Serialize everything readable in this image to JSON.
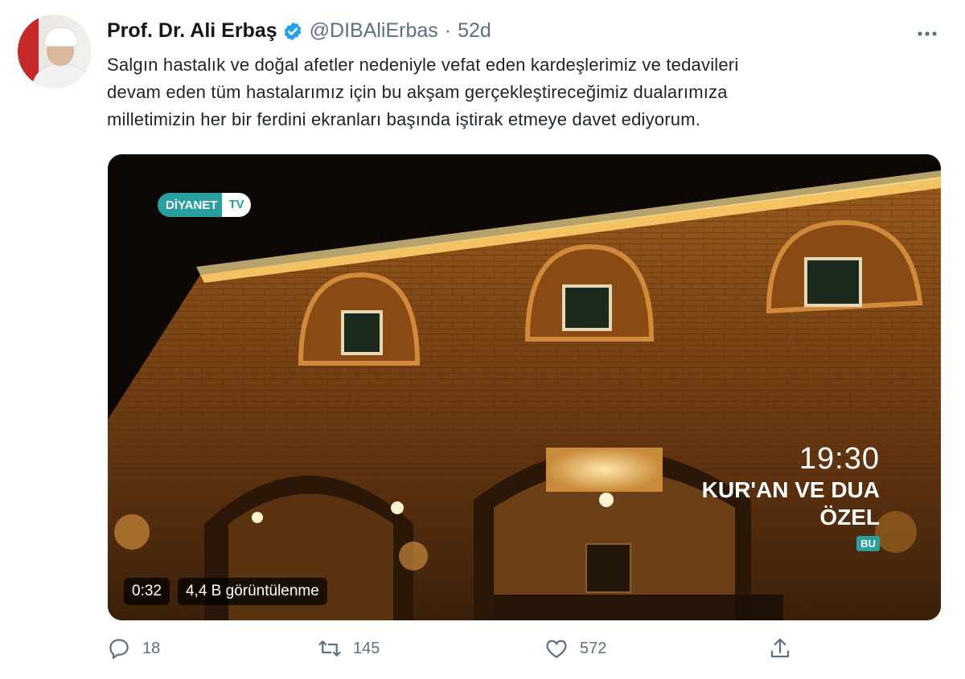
{
  "tweet": {
    "author_name": "Prof. Dr. Ali Erbaş",
    "handle": "@DIBAliErbas",
    "separator": "·",
    "time": "52d",
    "text_line1": "Salgın hastalık ve doğal afetler nedeniyle vefat eden kardeşlerimiz ve tedavileri",
    "text_line2": "devam eden tüm hastalarımız için bu akşam gerçekleştireceğimiz dualarımıza",
    "text_line3": "milletimizin her bir ferdini ekranları başında iştirak etmeye davet ediyorum.",
    "more_icon": "more-horizontal-icon"
  },
  "media": {
    "channel_logo_part1": "DİYANET",
    "channel_logo_part2": "TV",
    "promo_time": "19:30",
    "promo_title_line1": "KUR'AN VE DUA",
    "promo_title_line2": "ÖZEL",
    "promo_badge": "BU",
    "duration": "0:32",
    "views": "4,4 B görüntülenme"
  },
  "actions": {
    "reply_count": "18",
    "retweet_count": "145",
    "like_count": "572",
    "reply_icon": "reply-icon",
    "retweet_icon": "retweet-icon",
    "like_icon": "heart-icon",
    "share_icon": "share-icon"
  },
  "colors": {
    "verified_blue": "#1da1f2",
    "accent_teal": "#2a9fa0",
    "muted_text": "#5b7083"
  }
}
